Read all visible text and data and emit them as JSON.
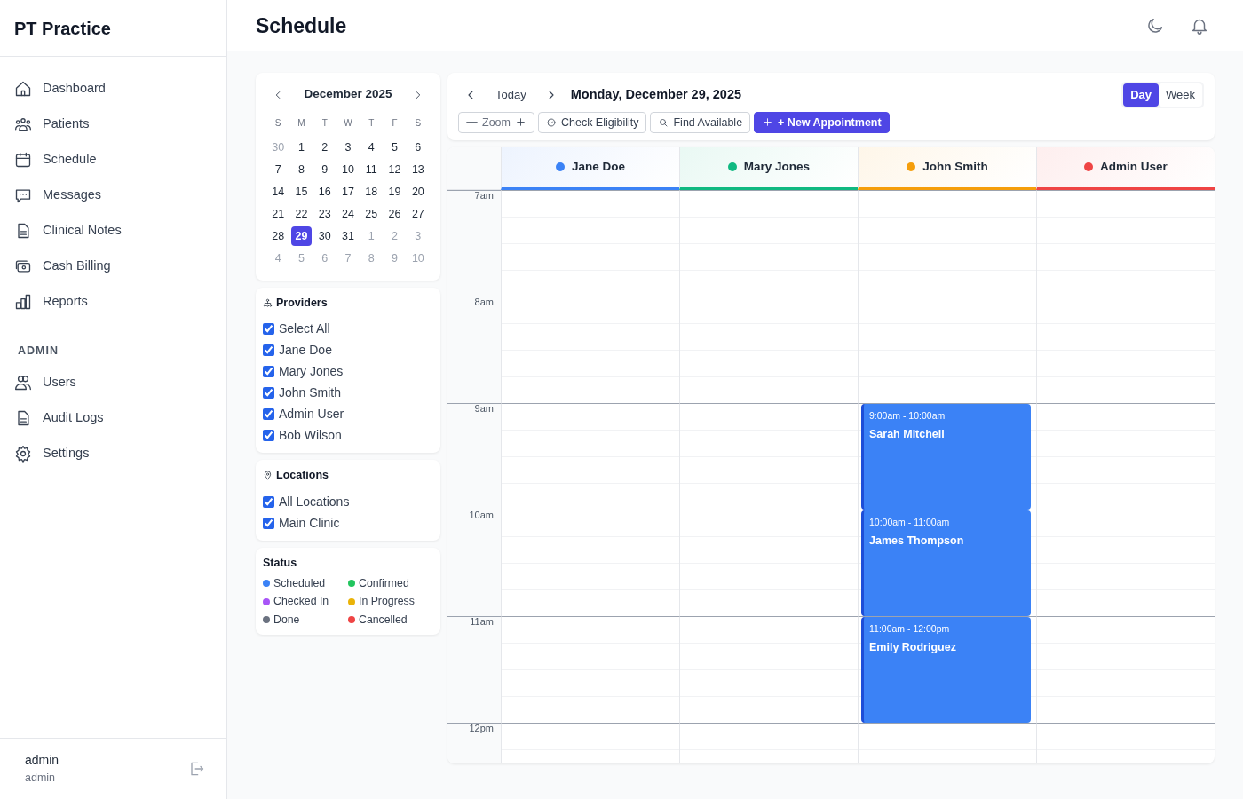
{
  "sidebar": {
    "title": "PT Practice",
    "nav_items": [
      {
        "label": "Dashboard"
      },
      {
        "label": "Patients"
      },
      {
        "label": "Schedule"
      },
      {
        "label": "Messages"
      },
      {
        "label": "Clinical Notes"
      },
      {
        "label": "Cash Billing"
      },
      {
        "label": "Reports"
      }
    ],
    "admin_heading": "ADMIN",
    "admin_items": [
      {
        "label": "Users"
      },
      {
        "label": "Audit Logs"
      },
      {
        "label": "Settings"
      }
    ],
    "user": {
      "name": "admin",
      "role": "admin"
    }
  },
  "header": {
    "title": "Schedule"
  },
  "mini_calendar": {
    "month": "December 2025",
    "weekdays": [
      "S",
      "M",
      "T",
      "W",
      "T",
      "F",
      "S"
    ],
    "days": [
      {
        "label": "30",
        "muted": true,
        "selected": false
      },
      {
        "label": "1",
        "muted": false,
        "selected": false
      },
      {
        "label": "2",
        "muted": false,
        "selected": false
      },
      {
        "label": "3",
        "muted": false,
        "selected": false
      },
      {
        "label": "4",
        "muted": false,
        "selected": false
      },
      {
        "label": "5",
        "muted": false,
        "selected": false
      },
      {
        "label": "6",
        "muted": false,
        "selected": false
      },
      {
        "label": "7",
        "muted": false,
        "selected": false
      },
      {
        "label": "8",
        "muted": false,
        "selected": false
      },
      {
        "label": "9",
        "muted": false,
        "selected": false
      },
      {
        "label": "10",
        "muted": false,
        "selected": false
      },
      {
        "label": "11",
        "muted": false,
        "selected": false
      },
      {
        "label": "12",
        "muted": false,
        "selected": false
      },
      {
        "label": "13",
        "muted": false,
        "selected": false
      },
      {
        "label": "14",
        "muted": false,
        "selected": false
      },
      {
        "label": "15",
        "muted": false,
        "selected": false
      },
      {
        "label": "16",
        "muted": false,
        "selected": false
      },
      {
        "label": "17",
        "muted": false,
        "selected": false
      },
      {
        "label": "18",
        "muted": false,
        "selected": false
      },
      {
        "label": "19",
        "muted": false,
        "selected": false
      },
      {
        "label": "20",
        "muted": false,
        "selected": false
      },
      {
        "label": "21",
        "muted": false,
        "selected": false
      },
      {
        "label": "22",
        "muted": false,
        "selected": false
      },
      {
        "label": "23",
        "muted": false,
        "selected": false
      },
      {
        "label": "24",
        "muted": false,
        "selected": false
      },
      {
        "label": "25",
        "muted": false,
        "selected": false
      },
      {
        "label": "26",
        "muted": false,
        "selected": false
      },
      {
        "label": "27",
        "muted": false,
        "selected": false
      },
      {
        "label": "28",
        "muted": false,
        "selected": false
      },
      {
        "label": "29",
        "muted": false,
        "selected": true
      },
      {
        "label": "30",
        "muted": false,
        "selected": false
      },
      {
        "label": "31",
        "muted": false,
        "selected": false
      },
      {
        "label": "1",
        "muted": true,
        "selected": false
      },
      {
        "label": "2",
        "muted": true,
        "selected": false
      },
      {
        "label": "3",
        "muted": true,
        "selected": false
      },
      {
        "label": "4",
        "muted": true,
        "selected": false
      },
      {
        "label": "5",
        "muted": true,
        "selected": false
      },
      {
        "label": "6",
        "muted": true,
        "selected": false
      },
      {
        "label": "7",
        "muted": true,
        "selected": false
      },
      {
        "label": "8",
        "muted": true,
        "selected": false
      },
      {
        "label": "9",
        "muted": true,
        "selected": false
      },
      {
        "label": "10",
        "muted": true,
        "selected": false
      }
    ]
  },
  "providers_filter": {
    "title": "Providers",
    "options": [
      {
        "label": "Select All",
        "checked": true
      },
      {
        "label": "Jane Doe",
        "checked": true
      },
      {
        "label": "Mary Jones",
        "checked": true
      },
      {
        "label": "John Smith",
        "checked": true
      },
      {
        "label": "Admin User",
        "checked": true
      },
      {
        "label": "Bob Wilson",
        "checked": true
      }
    ]
  },
  "locations_filter": {
    "title": "Locations",
    "options": [
      {
        "label": "All Locations",
        "checked": true
      },
      {
        "label": "Main Clinic",
        "checked": true
      }
    ]
  },
  "status_legend": {
    "title": "Status",
    "items": [
      {
        "label": "Scheduled",
        "color": "#3b82f6"
      },
      {
        "label": "Confirmed",
        "color": "#22c55e"
      },
      {
        "label": "Checked In",
        "color": "#a855f7"
      },
      {
        "label": "In Progress",
        "color": "#eab308"
      },
      {
        "label": "Done",
        "color": "#6b7280"
      },
      {
        "label": "Cancelled",
        "color": "#ef4444"
      }
    ]
  },
  "toolbar": {
    "today": "Today",
    "date": "Monday, December 29, 2025",
    "views": [
      {
        "label": "Day",
        "selected": true
      },
      {
        "label": "Week",
        "selected": false
      }
    ],
    "zoom": "Zoom",
    "buttons": [
      {
        "label": "Check Eligibility",
        "kind": "check"
      },
      {
        "label": "Find Available",
        "kind": "search"
      },
      {
        "label": "+ New Appointment",
        "kind": "primary"
      }
    ]
  },
  "schedule": {
    "providers": [
      {
        "name": "Jane Doe",
        "color": "#3b82f6"
      },
      {
        "name": "Mary Jones",
        "color": "#10b981"
      },
      {
        "name": "John Smith",
        "color": "#f59e0b"
      },
      {
        "name": "Admin User",
        "color": "#ef4444"
      }
    ],
    "hours": [
      {
        "label": "7am",
        "cells": [
          null,
          null,
          null,
          null
        ]
      },
      {
        "label": "8am",
        "cells": [
          null,
          null,
          null,
          null
        ]
      },
      {
        "label": "9am",
        "cells": [
          null,
          null,
          {
            "time": "9:00am - 10:00am",
            "patient": "Sarah Mitchell"
          },
          null
        ]
      },
      {
        "label": "10am",
        "cells": [
          null,
          null,
          {
            "time": "10:00am - 11:00am",
            "patient": "James Thompson"
          },
          null
        ]
      },
      {
        "label": "11am",
        "cells": [
          null,
          null,
          {
            "time": "11:00am - 12:00pm",
            "patient": "Emily Rodriguez"
          },
          null
        ]
      },
      {
        "label": "12pm",
        "cells": [
          null,
          null,
          null,
          null
        ]
      }
    ]
  }
}
